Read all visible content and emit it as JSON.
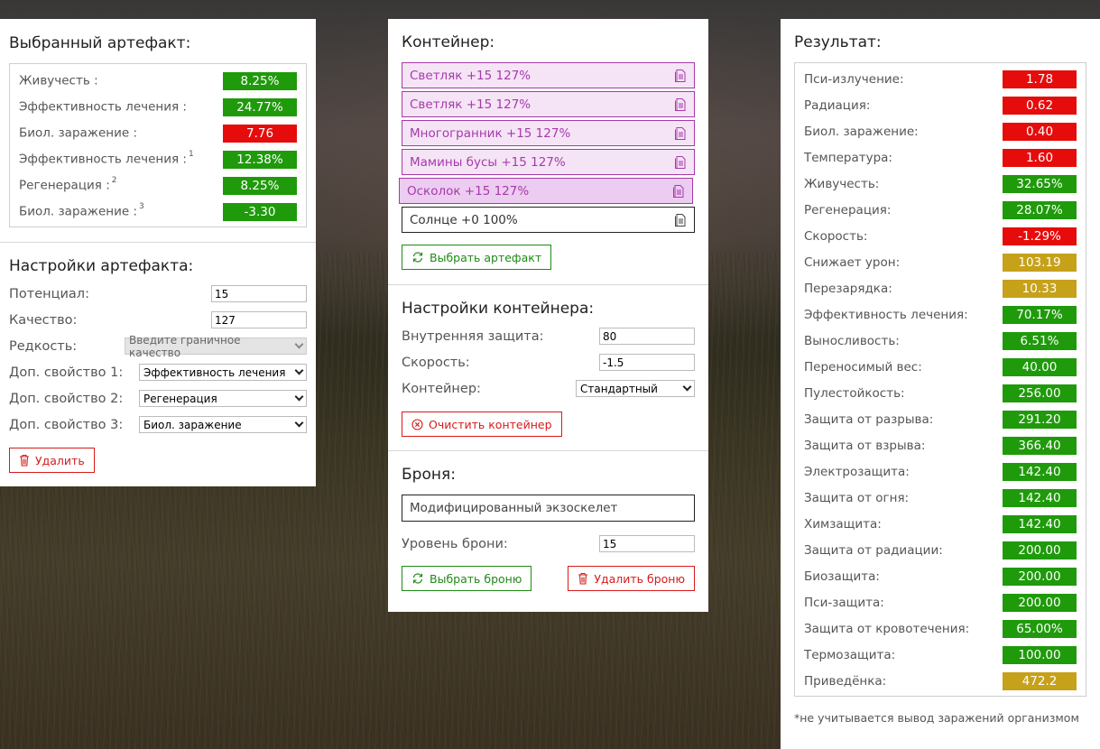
{
  "selected_artifact": {
    "title": "Выбранный артефакт:",
    "stats": [
      {
        "label": "Живучесть :",
        "sup": "",
        "value": "8.25%",
        "color": "green"
      },
      {
        "label": "Эффективность лечения :",
        "sup": "",
        "value": "24.77%",
        "color": "green"
      },
      {
        "label": "Биол. заражение :",
        "sup": "",
        "value": "7.76",
        "color": "red"
      },
      {
        "label": "Эффективность лечения :",
        "sup": "1",
        "value": "12.38%",
        "color": "green"
      },
      {
        "label": "Регенерация :",
        "sup": "2",
        "value": "8.25%",
        "color": "green"
      },
      {
        "label": "Биол. заражение :",
        "sup": "3",
        "value": "-3.30",
        "color": "green"
      }
    ]
  },
  "artifact_settings": {
    "title": "Настройки артефакта:",
    "potential_label": "Потенциал:",
    "potential_value": "15",
    "quality_label": "Качество:",
    "quality_value": "127",
    "rarity_label": "Редкость:",
    "rarity_value": "Введите граничное качество",
    "extra1_label": "Доп. свойство 1:",
    "extra1_value": "Эффективность лечения",
    "extra2_label": "Доп. свойство 2:",
    "extra2_value": "Регенерация",
    "extra3_label": "Доп. свойство 3:",
    "extra3_value": "Биол. заражение",
    "delete_label": "Удалить"
  },
  "container": {
    "title": "Контейнер:",
    "artifacts": [
      {
        "label": "Светляк +15 127%",
        "state": "filled"
      },
      {
        "label": "Светляк +15 127%",
        "state": "filled"
      },
      {
        "label": "Многогранник +15 127%",
        "state": "filled"
      },
      {
        "label": "Мамины бусы +15 127%",
        "state": "filled"
      },
      {
        "label": "Осколок +15 127%",
        "state": "selected"
      },
      {
        "label": "Солнце +0 100%",
        "state": "plain"
      }
    ],
    "choose_artifact_label": "Выбрать артефакт"
  },
  "container_settings": {
    "title": "Настройки контейнера:",
    "protection_label": "Внутренняя защита:",
    "protection_value": "80",
    "speed_label": "Скорость:",
    "speed_value": "-1.5",
    "container_label": "Контейнер:",
    "container_value": "Стандартный",
    "clear_label": "Очистить контейнер"
  },
  "armor": {
    "title": "Броня:",
    "name": "Модифицированный экзоскелет",
    "level_label": "Уровень брони:",
    "level_value": "15",
    "choose_label": "Выбрать броню",
    "delete_label": "Удалить броню"
  },
  "result": {
    "title": "Результат:",
    "stats": [
      {
        "label": "Пси-излучение:",
        "value": "1.78",
        "color": "red"
      },
      {
        "label": "Радиация:",
        "value": "0.62",
        "color": "red"
      },
      {
        "label": "Биол. заражение:",
        "value": "0.40",
        "color": "red"
      },
      {
        "label": "Температура:",
        "value": "1.60",
        "color": "red"
      },
      {
        "label": "Живучесть:",
        "value": "32.65%",
        "color": "green"
      },
      {
        "label": "Регенерация:",
        "value": "28.07%",
        "color": "green"
      },
      {
        "label": "Скорость:",
        "value": "-1.29%",
        "color": "red"
      },
      {
        "label": "Снижает урон:",
        "value": "103.19",
        "color": "gold"
      },
      {
        "label": "Перезарядка:",
        "value": "10.33",
        "color": "gold"
      },
      {
        "label": "Эффективность лечения:",
        "value": "70.17%",
        "color": "green"
      },
      {
        "label": "Выносливость:",
        "value": "6.51%",
        "color": "green"
      },
      {
        "label": "Переносимый вес:",
        "value": "40.00",
        "color": "green"
      },
      {
        "label": "Пулестойкость:",
        "value": "256.00",
        "color": "green"
      },
      {
        "label": "Защита от разрыва:",
        "value": "291.20",
        "color": "green"
      },
      {
        "label": "Защита от взрыва:",
        "value": "366.40",
        "color": "green"
      },
      {
        "label": "Электрозащита:",
        "value": "142.40",
        "color": "green"
      },
      {
        "label": "Защита от огня:",
        "value": "142.40",
        "color": "green"
      },
      {
        "label": "Химзащита:",
        "value": "142.40",
        "color": "green"
      },
      {
        "label": "Защита от радиации:",
        "value": "200.00",
        "color": "green"
      },
      {
        "label": "Биозащита:",
        "value": "200.00",
        "color": "green"
      },
      {
        "label": "Пси-защита:",
        "value": "200.00",
        "color": "green"
      },
      {
        "label": "Защита от кровотечения:",
        "value": "65.00%",
        "color": "green"
      },
      {
        "label": "Термозащита:",
        "value": "100.00",
        "color": "green"
      },
      {
        "label": "Приведёнка:",
        "value": "472.2",
        "color": "gold"
      }
    ],
    "footnote": "*не учитывается вывод заражений организмом"
  },
  "colors": {
    "green": "#1f9a0b",
    "red": "#e60c0c",
    "gold": "#c6a11a",
    "artifact_purple": "#a63aab"
  }
}
